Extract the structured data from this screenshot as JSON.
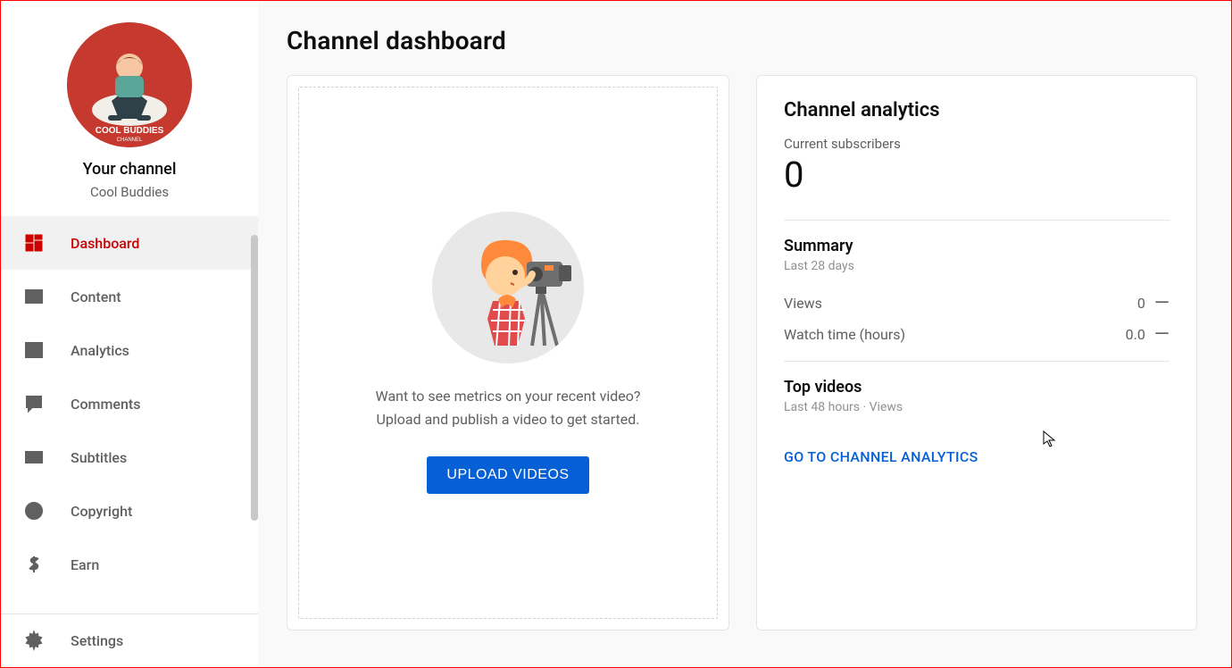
{
  "sidebar": {
    "your_channel_label": "Your channel",
    "channel_name": "Cool Buddies",
    "avatar_text_top": "COOL BUDDIES",
    "avatar_text_bottom": "CHANNEL",
    "items": [
      {
        "label": "Dashboard",
        "icon": "dashboard-icon",
        "active": true
      },
      {
        "label": "Content",
        "icon": "content-icon",
        "active": false
      },
      {
        "label": "Analytics",
        "icon": "analytics-icon",
        "active": false
      },
      {
        "label": "Comments",
        "icon": "comments-icon",
        "active": false
      },
      {
        "label": "Subtitles",
        "icon": "subtitles-icon",
        "active": false
      },
      {
        "label": "Copyright",
        "icon": "copyright-icon",
        "active": false
      },
      {
        "label": "Earn",
        "icon": "earn-icon",
        "active": false
      }
    ],
    "settings_label": "Settings"
  },
  "main": {
    "page_title": "Channel dashboard",
    "upload": {
      "prompt_line1": "Want to see metrics on your recent video?",
      "prompt_line2": "Upload and publish a video to get started.",
      "button_label": "UPLOAD VIDEOS"
    },
    "analytics": {
      "title": "Channel analytics",
      "subscribers_label": "Current subscribers",
      "subscribers_value": "0",
      "summary_title": "Summary",
      "summary_sub": "Last 28 days",
      "rows": [
        {
          "label": "Views",
          "value": "0",
          "delta": "—"
        },
        {
          "label": "Watch time (hours)",
          "value": "0.0",
          "delta": "—"
        }
      ],
      "top_title": "Top videos",
      "top_sub": "Last 48 hours · Views",
      "go_link": "GO TO CHANNEL ANALYTICS"
    }
  }
}
